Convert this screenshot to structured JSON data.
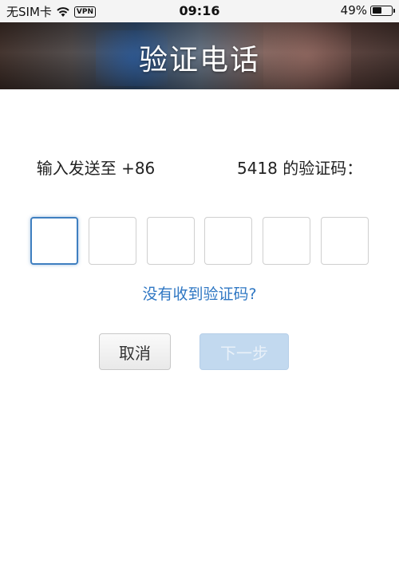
{
  "status_bar": {
    "carrier": "无SIM卡",
    "vpn": "VPN",
    "time": "09:16",
    "battery_text": "49%",
    "battery_level": 0.49
  },
  "header": {
    "title": "验证电话"
  },
  "instruction": {
    "prefix": "输入发送至 +86 ",
    "suffix": " 5418 的验证码："
  },
  "code_input": {
    "length": 6,
    "active_index": 0
  },
  "resend_link": "没有收到验证码?",
  "buttons": {
    "cancel": "取消",
    "next": "下一步"
  },
  "colors": {
    "accent": "#2f77c3",
    "active_border": "#3f7fc0",
    "next_disabled_bg": "#c2d9ef"
  }
}
